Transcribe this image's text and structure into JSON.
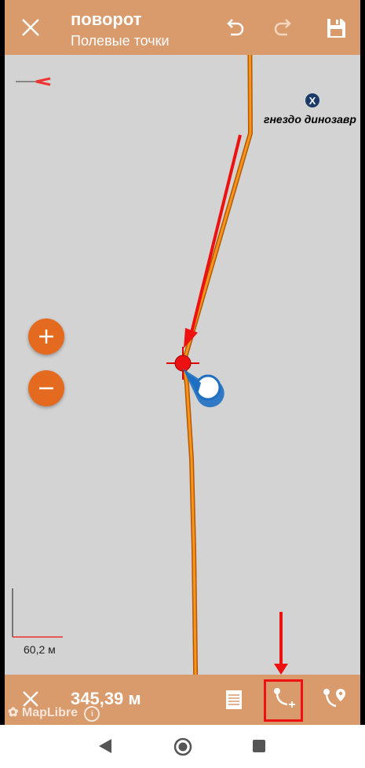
{
  "header": {
    "title": "поворот",
    "subtitle": "Полевые точки",
    "close_icon": "close-icon",
    "undo_icon": "undo-icon",
    "redo_icon": "redo-icon",
    "save_icon": "save-icon"
  },
  "map": {
    "poi_label": "гнездо динозавр",
    "scale_label": "60,2 м",
    "attribution": "MapLibre",
    "zoom_in_icon": "plus-icon",
    "zoom_out_icon": "minus-icon"
  },
  "footer": {
    "distance": "345,39 м",
    "close_icon": "close-icon",
    "list_icon": "list-icon",
    "add_point_icon": "add-route-point-icon",
    "route_point_icon": "route-marker-icon"
  },
  "nav": {
    "back_icon": "back-triangle-icon",
    "home_icon": "home-circle-icon",
    "recents_icon": "recents-square-icon"
  },
  "colors": {
    "accent": "#d99a6c",
    "route": "#f7931e",
    "fab": "#e36a1e",
    "annotation": "#ee1111"
  }
}
